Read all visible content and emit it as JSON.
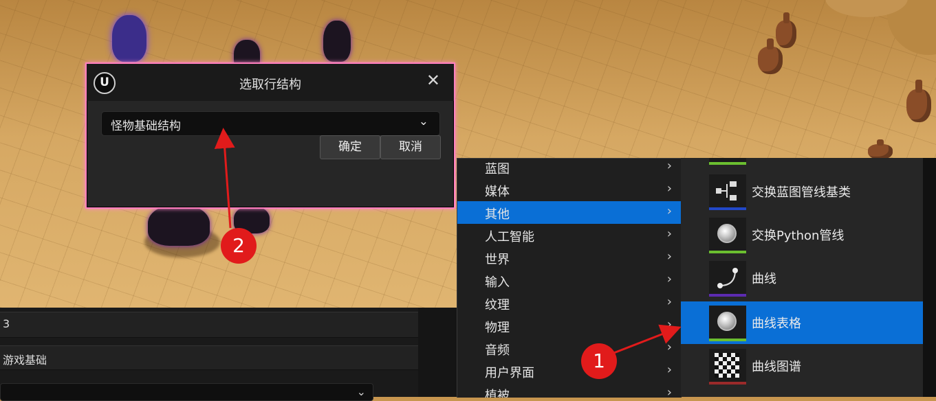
{
  "dialog": {
    "title": "选取行结构",
    "logo": "U",
    "close_glyph": "✕",
    "struct_value": "怪物基础结构",
    "dropdown_glyph": "⌄",
    "ok_label": "确定",
    "cancel_label": "取消"
  },
  "bottom": {
    "row1_text": "3",
    "row2_text": "游戏基础",
    "dropdown_glyph": "⌄"
  },
  "menu": {
    "arrow_glyph": "›",
    "items": [
      {
        "label": "蓝图"
      },
      {
        "label": "媒体"
      },
      {
        "label": "其他",
        "active": true
      },
      {
        "label": "人工智能"
      },
      {
        "label": "世界"
      },
      {
        "label": "输入"
      },
      {
        "label": "纹理"
      },
      {
        "label": "物理"
      },
      {
        "label": "音频"
      },
      {
        "label": "用户界面"
      },
      {
        "label": "植被"
      }
    ]
  },
  "submenu": {
    "items": [
      {
        "label": "",
        "icon": "blueprint-icon"
      },
      {
        "label": "交换蓝图管线基类",
        "icon": "pipeline-node-icon"
      },
      {
        "label": "交换Python管线",
        "icon": "sphere-asset-icon"
      },
      {
        "label": "曲线",
        "icon": "curve-icon"
      },
      {
        "label": "曲线表格",
        "icon": "sphere-asset-icon",
        "active": true
      },
      {
        "label": "曲线图谱",
        "icon": "checker-atlas-icon"
      }
    ]
  },
  "annotations": {
    "marker1": "1",
    "marker2": "2",
    "color": "#e11b1b"
  },
  "colors": {
    "accent": "#0a6fd6",
    "dialog_border": "#ff7fbf"
  }
}
